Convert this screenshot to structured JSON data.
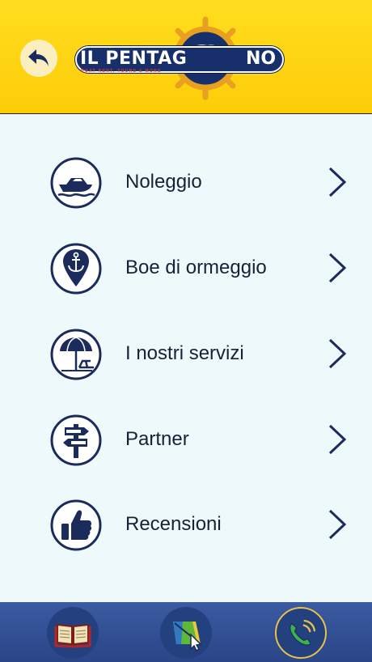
{
  "header": {
    "back_icon": "back-arrow-icon",
    "logo": {
      "text_left": "IL PENTAG",
      "text_right": "NO",
      "tagline": "BOAT RENT, TOURS & MORE",
      "colors": {
        "navy": "#172f6b",
        "gold": "#e8a020",
        "tagline": "#e8352b"
      }
    }
  },
  "menu": {
    "items": [
      {
        "label": "Noleggio",
        "icon": "motorboat-icon"
      },
      {
        "label": "Boe di ormeggio",
        "icon": "anchor-pin-icon"
      },
      {
        "label": "I nostri servizi",
        "icon": "beach-umbrella-icon"
      },
      {
        "label": "Partner",
        "icon": "signpost-icon"
      },
      {
        "label": "Recensioni",
        "icon": "thumbs-up-icon"
      }
    ]
  },
  "bottom_nav": {
    "tabs": [
      {
        "icon": "open-book-icon"
      },
      {
        "icon": "map-pointer-icon"
      },
      {
        "icon": "phone-call-icon"
      }
    ]
  },
  "colors": {
    "header": "#fdd20f",
    "background": "#eef9fc",
    "icon_navy": "#1a2b5c",
    "bottom_bar": "#3356a0"
  }
}
